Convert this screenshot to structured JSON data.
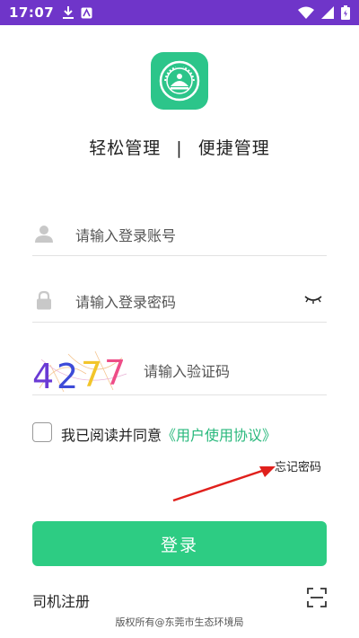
{
  "status_bar": {
    "time": "17:07"
  },
  "slogan": {
    "left": "轻松管理",
    "separator": "|",
    "right": "便捷管理"
  },
  "form": {
    "account_placeholder": "请输入登录账号",
    "password_placeholder": "请输入登录密码",
    "captcha_code": [
      "4",
      "2",
      "7",
      "7"
    ],
    "captcha_placeholder": "请输入验证码"
  },
  "agreement": {
    "prefix": "我已阅读并同意",
    "link": "《用户使用协议》",
    "checked": false
  },
  "forgot_password": "忘记密码",
  "login_button": "登录",
  "driver_register": "司机注册",
  "copyright": "版权所有@东莞市生态环境局",
  "colors": {
    "status_bar": "#6f35c9",
    "accent": "#2dcc83",
    "link": "#28b87c"
  },
  "icons": {
    "status": [
      "download-icon",
      "app-icon",
      "wifi-icon",
      "signal-icon",
      "battery-icon"
    ],
    "account": "user-icon",
    "password": "lock-icon",
    "toggle": "eye-closed-icon",
    "scan": "scan-icon",
    "annotation": "red-arrow-icon"
  }
}
